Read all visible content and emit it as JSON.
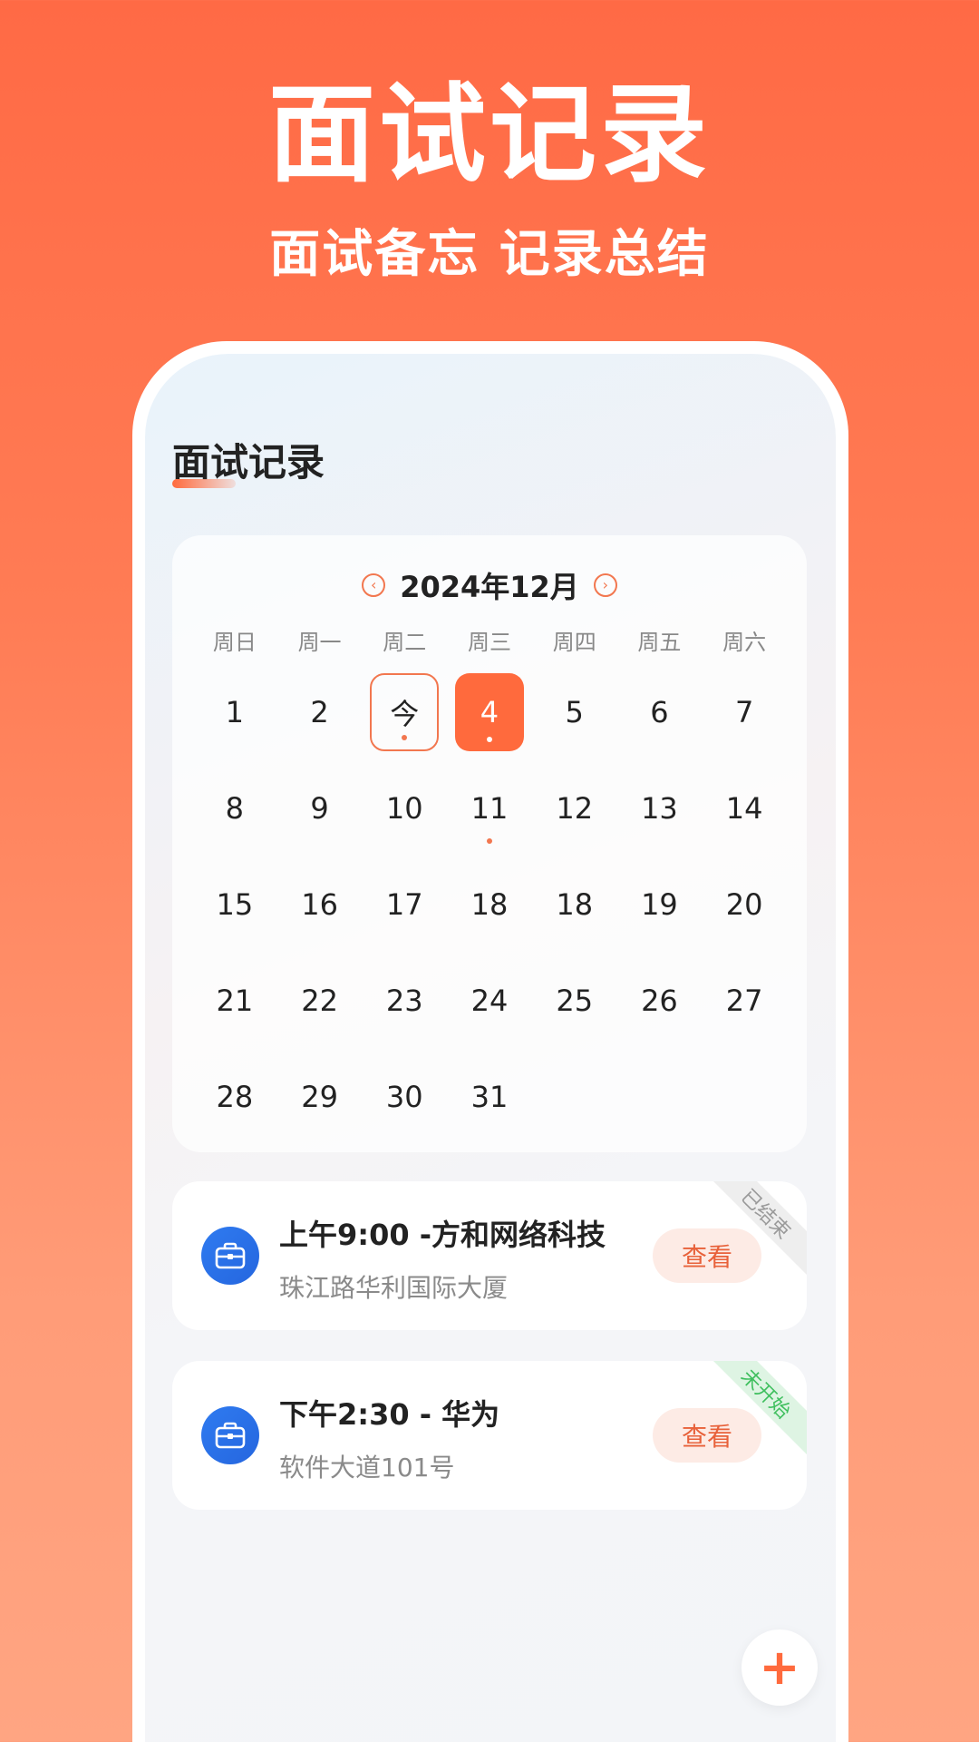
{
  "promo": {
    "title": "面试记录",
    "subtitle": "面试备忘 记录总结"
  },
  "screen": {
    "title": "面试记录"
  },
  "calendar": {
    "month_label": "2024年12月",
    "prev_icon": "chevron-left-icon",
    "next_icon": "chevron-right-icon",
    "weekdays": [
      "周日",
      "周一",
      "周二",
      "周三",
      "周四",
      "周五",
      "周六"
    ],
    "days": [
      {
        "label": "1"
      },
      {
        "label": "2"
      },
      {
        "label": "今",
        "today": true,
        "dot": true
      },
      {
        "label": "4",
        "selected": true,
        "dot": true
      },
      {
        "label": "5"
      },
      {
        "label": "6"
      },
      {
        "label": "7"
      },
      {
        "label": "8"
      },
      {
        "label": "9"
      },
      {
        "label": "10"
      },
      {
        "label": "11",
        "dot": true
      },
      {
        "label": "12"
      },
      {
        "label": "13"
      },
      {
        "label": "14"
      },
      {
        "label": "15"
      },
      {
        "label": "16"
      },
      {
        "label": "17"
      },
      {
        "label": "18"
      },
      {
        "label": "18"
      },
      {
        "label": "19"
      },
      {
        "label": "20"
      },
      {
        "label": "21"
      },
      {
        "label": "22"
      },
      {
        "label": "23"
      },
      {
        "label": "24"
      },
      {
        "label": "25"
      },
      {
        "label": "26"
      },
      {
        "label": "27"
      },
      {
        "label": "28"
      },
      {
        "label": "29"
      },
      {
        "label": "30"
      },
      {
        "label": "31"
      }
    ]
  },
  "interviews": [
    {
      "title": "上午9:00 -方和网络科技",
      "address": "珠江路华利国际大厦",
      "button_label": "查看",
      "status": "已结束",
      "icon": "briefcase-icon"
    },
    {
      "title": "下午2:30 - 华为",
      "address": "软件大道101号",
      "button_label": "查看",
      "status": "未开始",
      "icon": "briefcase-icon"
    }
  ],
  "fab": {
    "label": "+",
    "icon": "plus-icon"
  },
  "colors": {
    "accent": "#ff6a3d",
    "brand_blue": "#2f7bf0",
    "status_done": "#9a9a9a",
    "status_pending": "#3fbf5e"
  }
}
